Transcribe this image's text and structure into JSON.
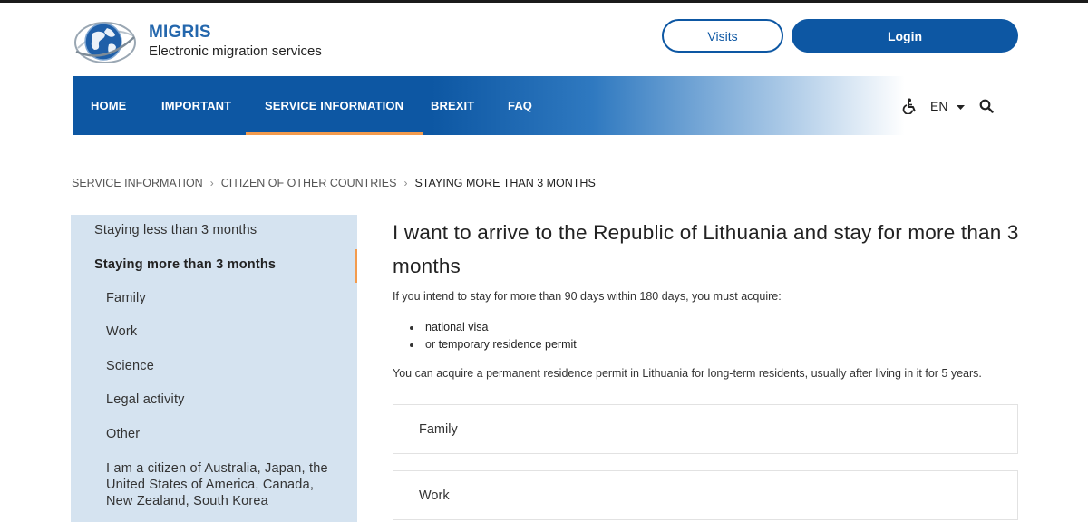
{
  "header": {
    "brand_name": "MIGRIS",
    "brand_subtitle": "Electronic migration services",
    "visits_label": "Visits",
    "login_label": "Login"
  },
  "nav": {
    "items": [
      {
        "label": "HOME"
      },
      {
        "label": "IMPORTANT"
      },
      {
        "label": "SERVICE INFORMATION"
      },
      {
        "label": "BREXIT"
      },
      {
        "label": "FAQ"
      }
    ],
    "active": "SERVICE INFORMATION",
    "language": "EN",
    "icons": [
      "accessibility-icon",
      "caret-down-icon",
      "search-icon"
    ]
  },
  "breadcrumb": {
    "items": [
      "SERVICE INFORMATION",
      "CITIZEN OF OTHER COUNTRIES",
      "STAYING MORE THAN 3 MONTHS"
    ]
  },
  "sidebar": {
    "items": [
      {
        "label": "Staying less than 3 months"
      },
      {
        "label": "Staying more than 3 months"
      },
      {
        "label": "Family"
      },
      {
        "label": "Work"
      },
      {
        "label": "Science"
      },
      {
        "label": "Legal activity"
      },
      {
        "label": "Other"
      },
      {
        "label": "I am a citizen of Australia, Japan, the United States of America, Canada, New Zealand, South Korea"
      }
    ],
    "active": "Staying more than 3 months"
  },
  "main": {
    "title": "I want to arrive to the Republic of Lithuania and stay for more than 3 months",
    "intro": "If you intend to stay for more than 90 days within 180 days, you must acquire:",
    "bullets": [
      {
        "prefix": "",
        "term": "national visa"
      },
      {
        "prefix": "or ",
        "term": "temporary residence permit"
      }
    ],
    "permanent_note": "You can acquire a permanent residence permit in Lithuania for long-term residents, usually after living in it for 5 years.",
    "accordions": [
      {
        "label": "Family"
      },
      {
        "label": "Work"
      }
    ]
  },
  "colors": {
    "primary": "#0d57a3",
    "accent": "#f39b4d",
    "sidebar_bg": "#d5e3f0"
  }
}
